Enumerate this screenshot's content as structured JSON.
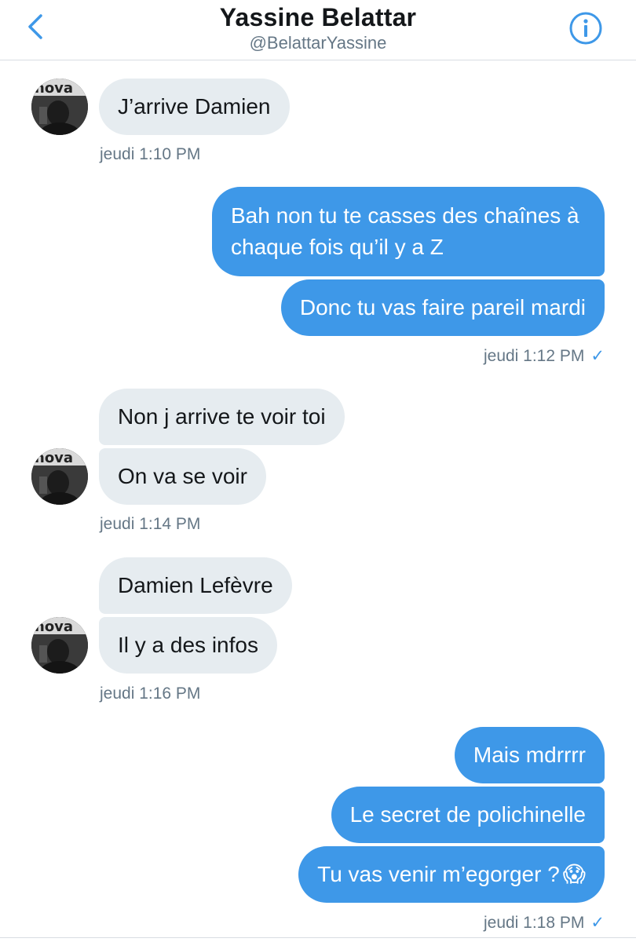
{
  "header": {
    "title": "Yassine Belattar",
    "handle": "@BelattarYassine"
  },
  "accent_color": "#3e98e8",
  "messages": [
    {
      "text": "J’arrive Damien"
    },
    {
      "text": "Bah non tu te casses des chaînes à chaque fois qu’il y a Z"
    },
    {
      "text": "Donc tu vas faire pareil mardi"
    },
    {
      "text": "Non j arrive te voir toi"
    },
    {
      "text": "On va se voir"
    },
    {
      "text": "Damien Lefèvre"
    },
    {
      "text": "Il y a des infos"
    },
    {
      "text": "Mais mdrrrr"
    },
    {
      "text": "Le secret de polichinelle"
    },
    {
      "text": "Tu vas venir m’egorger ?",
      "emoji": "😱"
    }
  ],
  "timestamps": [
    {
      "text": "jeudi 1:10 PM"
    },
    {
      "text": "jeudi 1:12 PM",
      "check": "✓"
    },
    {
      "text": "jeudi 1:14 PM"
    },
    {
      "text": "jeudi 1:16 PM"
    },
    {
      "text": "jeudi 1:18 PM",
      "check": "✓"
    }
  ],
  "icons": {
    "back": "chevron-left-icon",
    "info": "info-circle-icon"
  }
}
